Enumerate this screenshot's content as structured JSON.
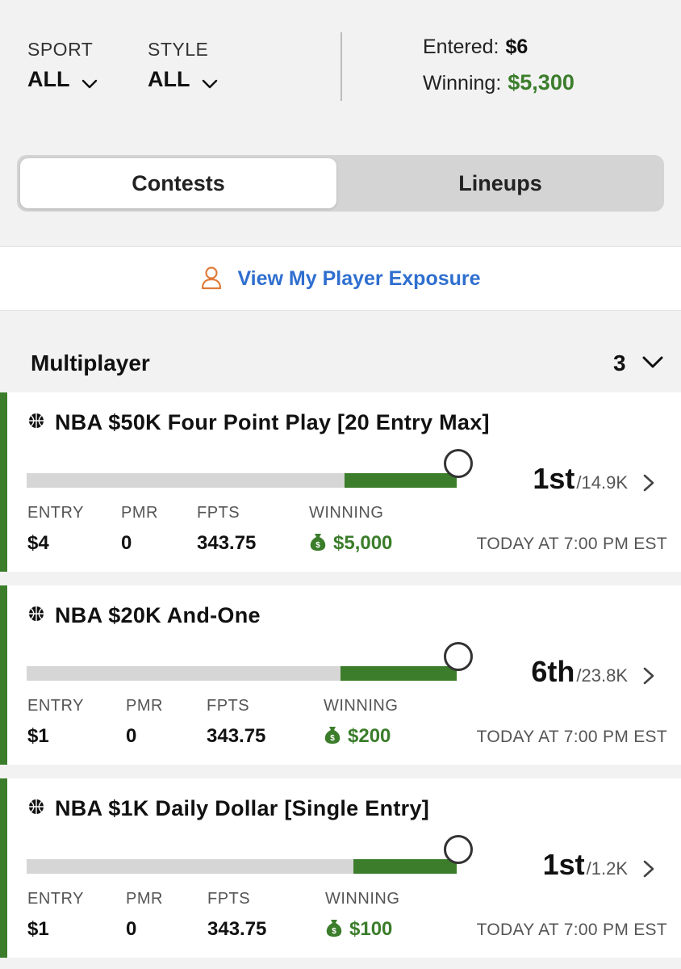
{
  "filters": {
    "sport": {
      "label": "SPORT",
      "value": "ALL"
    },
    "style": {
      "label": "STYLE",
      "value": "ALL"
    }
  },
  "summary": {
    "entered_label": "Entered:",
    "entered_value": "$6",
    "winning_label": "Winning:",
    "winning_value": "$5,300"
  },
  "tabs": {
    "contests": "Contests",
    "lineups": "Lineups",
    "active": "Contests"
  },
  "exposure": {
    "label": "View My Player Exposure"
  },
  "section": {
    "title": "Multiplayer",
    "count": "3"
  },
  "labels": {
    "entry": "ENTRY",
    "pmr": "PMR",
    "fpts": "FPTS",
    "winning": "WINNING"
  },
  "contests": [
    {
      "title": "NBA $50K Four Point Play [20 Entry Max]",
      "rank": "1st",
      "of": "/14.9K",
      "progress": 0.26,
      "entry": "$4",
      "pmr": "0",
      "fpts": "343.75",
      "winning": "$5,000",
      "time": "TODAY AT 7:00 PM EST"
    },
    {
      "title": "NBA $20K And-One",
      "rank": "6th",
      "of": "/23.8K",
      "progress": 0.27,
      "entry": "$1",
      "pmr": "0",
      "fpts": "343.75",
      "winning": "$200",
      "time": "TODAY AT 7:00 PM EST"
    },
    {
      "title": "NBA $1K Daily Dollar [Single Entry]",
      "rank": "1st",
      "of": "/1.2K",
      "progress": 0.24,
      "entry": "$1",
      "pmr": "0",
      "fpts": "343.75",
      "winning": "$100",
      "time": "TODAY AT 7:00 PM EST"
    }
  ],
  "colors": {
    "accent_green": "#3b7d2b",
    "link_blue": "#2f6fcf",
    "person_icon": "#e07b39"
  }
}
